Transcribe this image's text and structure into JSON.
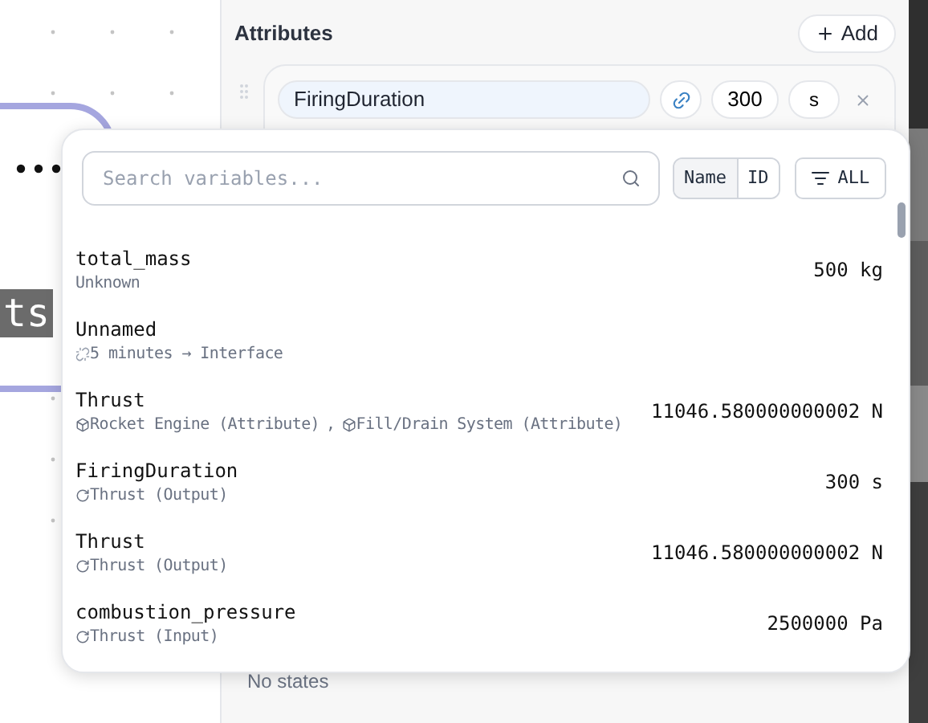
{
  "canvas": {
    "node_label": "ts"
  },
  "attributes": {
    "title": "Attributes",
    "add_button": "Add",
    "row": {
      "name": "FiringDuration",
      "linked": true,
      "value": "300",
      "unit": "s"
    },
    "states_text": "No states"
  },
  "popover": {
    "search": {
      "placeholder": "Search variables..."
    },
    "toggle": [
      {
        "label": "Name",
        "selected": true
      },
      {
        "label": "ID",
        "selected": false
      }
    ],
    "filter_button": "ALL",
    "variables": [
      {
        "name": "total_mass",
        "sources": [
          {
            "kind": "plain",
            "text": "Unknown"
          }
        ],
        "value": "500 kg"
      },
      {
        "name": "Unnamed",
        "sources": [
          {
            "kind": "link",
            "text": "5 minutes → Interface"
          }
        ]
      },
      {
        "name": "Thrust",
        "sources": [
          {
            "kind": "block",
            "text": "Rocket Engine (Attribute)"
          },
          {
            "kind": "block",
            "text": "Fill/Drain System (Attribute)"
          }
        ],
        "separator": ",",
        "value": "11046.580000000002 N"
      },
      {
        "name": "FiringDuration",
        "sources": [
          {
            "kind": "function",
            "text": "Thrust (Output)"
          }
        ],
        "value": "300 s"
      },
      {
        "name": "Thrust",
        "sources": [
          {
            "kind": "function",
            "text": "Thrust (Output)"
          }
        ],
        "value": "11046.580000000002 N"
      },
      {
        "name": "combustion_pressure",
        "sources": [
          {
            "kind": "function",
            "text": "Thrust (Input)"
          }
        ],
        "value": "2500000 Pa"
      }
    ]
  }
}
